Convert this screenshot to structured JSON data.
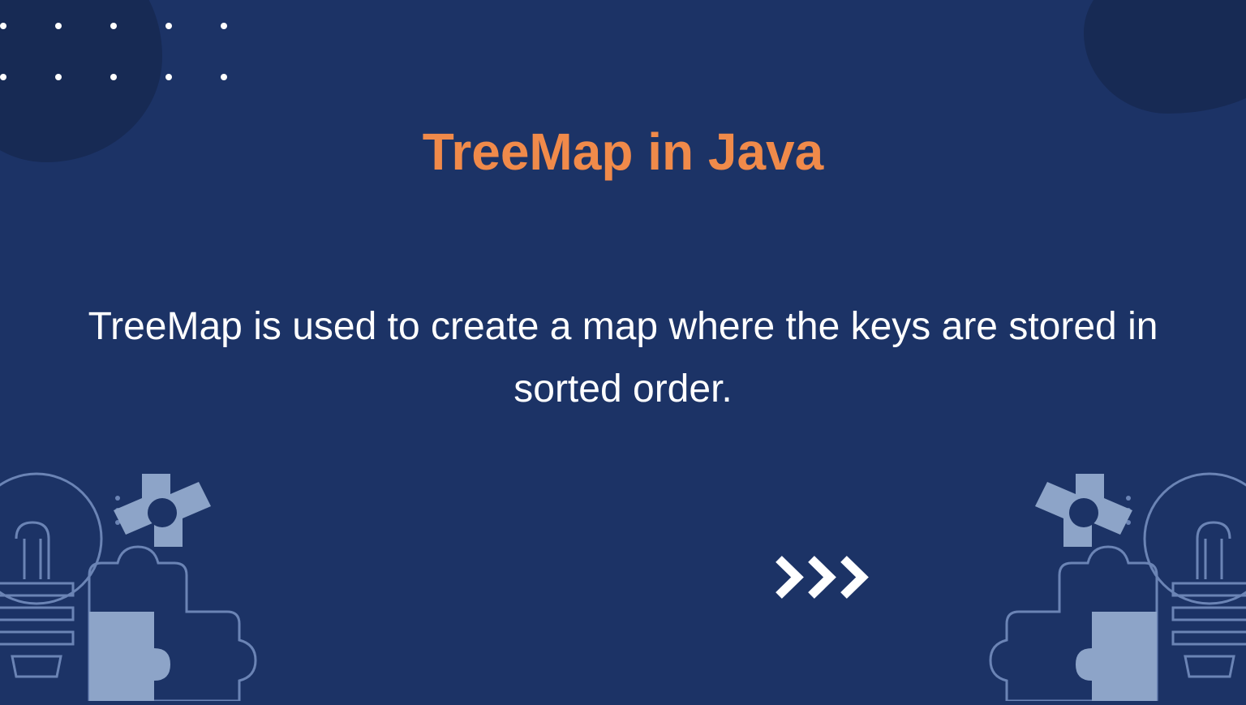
{
  "title": "TreeMap in Java",
  "description": "TreeMap is used to create a map where the keys are stored in sorted order.",
  "colors": {
    "background": "#1c3366",
    "accent": "#f08a4a",
    "blob": "#172a54",
    "graphic_outline": "#6b84b5",
    "graphic_fill": "#8da4c8"
  }
}
